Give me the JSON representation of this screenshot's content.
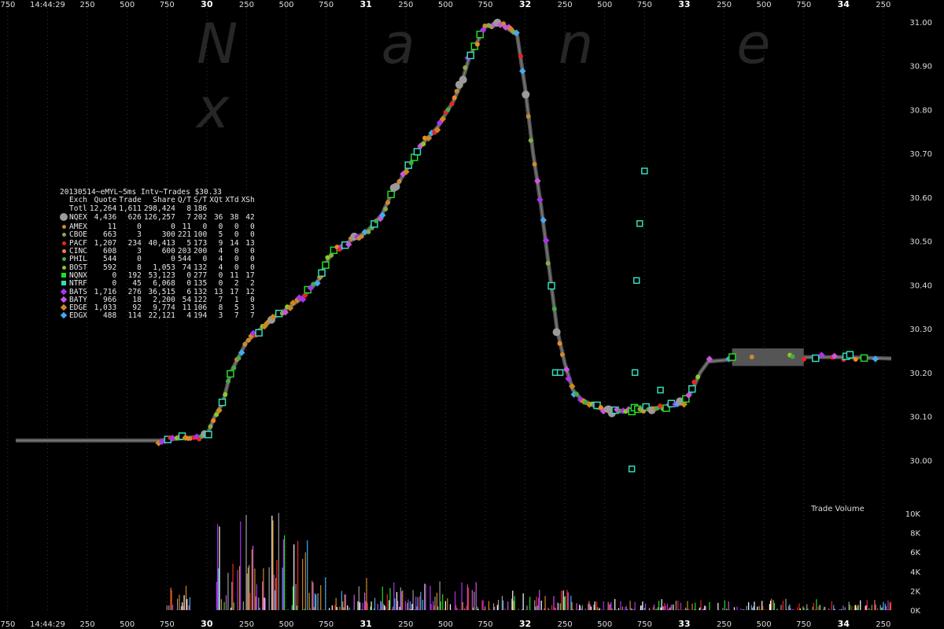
{
  "watermark": "N a n e x",
  "legend": {
    "title": "20130514~eMYL~5ms Intv~Trades $30.33",
    "columns": [
      "Exch",
      "Quote",
      "Trade",
      "Share",
      "Q/T",
      "S/T",
      "XQt",
      "XTd",
      "XSh"
    ],
    "rows": [
      {
        "exch": "Totl",
        "quote": "12,264",
        "trade": "1,611",
        "share": "298,424",
        "qt": "8",
        "st": "186",
        "xqt": "",
        "xtd": "",
        "xsh": "",
        "color": "",
        "shape": "none"
      },
      {
        "exch": "NQEX",
        "quote": "4,436",
        "trade": "626",
        "share": "126,257",
        "qt": "7",
        "st": "202",
        "xqt": "36",
        "xtd": "38",
        "xsh": "42",
        "color": "#9a9a9a",
        "shape": "circle"
      },
      {
        "exch": "AMEX",
        "quote": "11",
        "trade": "0",
        "share": "0",
        "qt": "11",
        "st": "0",
        "xqt": "0",
        "xtd": "0",
        "xsh": "0",
        "color": "#cc8833",
        "shape": "dot"
      },
      {
        "exch": "CBOE",
        "quote": "663",
        "trade": "3",
        "share": "300",
        "qt": "221",
        "st": "100",
        "xqt": "5",
        "xtd": "0",
        "xsh": "0",
        "color": "#88aa44",
        "shape": "dot"
      },
      {
        "exch": "PACF",
        "quote": "1,207",
        "trade": "234",
        "share": "40,413",
        "qt": "5",
        "st": "173",
        "xqt": "9",
        "xtd": "14",
        "xsh": "13",
        "color": "#ee2222",
        "shape": "dot"
      },
      {
        "exch": "CINC",
        "quote": "608",
        "trade": "3",
        "share": "600",
        "qt": "203",
        "st": "200",
        "xqt": "4",
        "xtd": "0",
        "xsh": "0",
        "color": "#ee8822",
        "shape": "dot"
      },
      {
        "exch": "PHIL",
        "quote": "544",
        "trade": "0",
        "share": "0",
        "qt": "544",
        "st": "0",
        "xqt": "4",
        "xtd": "0",
        "xsh": "0",
        "color": "#44aa44",
        "shape": "dot"
      },
      {
        "exch": "BOST",
        "quote": "592",
        "trade": "8",
        "share": "1,053",
        "qt": "74",
        "st": "132",
        "xqt": "4",
        "xtd": "0",
        "xsh": "0",
        "color": "#88cc22",
        "shape": "dot"
      },
      {
        "exch": "NQNX",
        "quote": "0",
        "trade": "192",
        "share": "53,123",
        "qt": "0",
        "st": "277",
        "xqt": "0",
        "xtd": "11",
        "xsh": "17",
        "color": "#22dd22",
        "shape": "square"
      },
      {
        "exch": "NTRF",
        "quote": "0",
        "trade": "45",
        "share": "6,068",
        "qt": "0",
        "st": "135",
        "xqt": "0",
        "xtd": "2",
        "xsh": "2",
        "color": "#33ddbb",
        "shape": "square"
      },
      {
        "exch": "BATS",
        "quote": "1,716",
        "trade": "276",
        "share": "36,515",
        "qt": "6",
        "st": "132",
        "xqt": "13",
        "xtd": "17",
        "xsh": "12",
        "color": "#aa33ee",
        "shape": "diamond"
      },
      {
        "exch": "BATY",
        "quote": "966",
        "trade": "18",
        "share": "2,200",
        "qt": "54",
        "st": "122",
        "xqt": "7",
        "xtd": "1",
        "xsh": "0",
        "color": "#cc55dd",
        "shape": "diamond"
      },
      {
        "exch": "EDGE",
        "quote": "1,033",
        "trade": "92",
        "share": "9,774",
        "qt": "11",
        "st": "106",
        "xqt": "8",
        "xtd": "5",
        "xsh": "3",
        "color": "#cc8822",
        "shape": "diamond"
      },
      {
        "exch": "EDGX",
        "quote": "488",
        "trade": "114",
        "share": "22,121",
        "qt": "4",
        "st": "194",
        "xqt": "3",
        "xtd": "7",
        "xsh": "7",
        "color": "#44aaee",
        "shape": "diamond"
      }
    ]
  },
  "chart_data": {
    "type": "scatter",
    "title": "20130514~eMYL~5ms Intv~Trades $30.33",
    "x_unit": "ms",
    "x_ticks": [
      "750",
      "14:44:29",
      "250",
      "500",
      "750",
      "30",
      "250",
      "500",
      "750",
      "31",
      "250",
      "500",
      "750",
      "32",
      "250",
      "500",
      "750",
      "33",
      "250",
      "500",
      "750",
      "34",
      "250"
    ],
    "x_tick_ms": [
      -250,
      0,
      250,
      500,
      750,
      1000,
      1250,
      1500,
      1750,
      2000,
      2250,
      2500,
      2750,
      3000,
      3250,
      3500,
      3750,
      4000,
      4250,
      4500,
      4750,
      5000,
      5250
    ],
    "major_tick_labels": [
      "30",
      "31",
      "32",
      "33",
      "34"
    ],
    "xlim_ms": [
      -200,
      5310
    ],
    "y_ticks": [
      "31.00",
      "30.90",
      "30.80",
      "30.70",
      "30.60",
      "30.50",
      "30.40",
      "30.30",
      "30.20",
      "30.10",
      "30.00"
    ],
    "ylim": [
      29.97,
      31.0
    ],
    "price_path": [
      [
        -200,
        30.045
      ],
      [
        700,
        30.045
      ],
      [
        1000,
        30.055
      ],
      [
        1050,
        30.1
      ],
      [
        1100,
        30.13
      ],
      [
        1150,
        30.2
      ],
      [
        1250,
        30.27
      ],
      [
        1400,
        30.32
      ],
      [
        1600,
        30.37
      ],
      [
        1700,
        30.41
      ],
      [
        1750,
        30.45
      ],
      [
        1800,
        30.48
      ],
      [
        1900,
        30.5
      ],
      [
        2000,
        30.52
      ],
      [
        2100,
        30.56
      ],
      [
        2150,
        30.6
      ],
      [
        2250,
        30.66
      ],
      [
        2350,
        30.72
      ],
      [
        2450,
        30.76
      ],
      [
        2550,
        30.82
      ],
      [
        2600,
        30.86
      ],
      [
        2650,
        30.92
      ],
      [
        2750,
        30.99
      ],
      [
        2850,
        30.995
      ],
      [
        2950,
        30.97
      ],
      [
        3000,
        30.85
      ],
      [
        3050,
        30.7
      ],
      [
        3100,
        30.58
      ],
      [
        3150,
        30.44
      ],
      [
        3200,
        30.3
      ],
      [
        3250,
        30.22
      ],
      [
        3300,
        30.16
      ],
      [
        3350,
        30.14
      ],
      [
        3450,
        30.12
      ],
      [
        3550,
        30.11
      ],
      [
        3700,
        30.115
      ],
      [
        3850,
        30.12
      ],
      [
        4000,
        30.13
      ],
      [
        4050,
        30.16
      ],
      [
        4100,
        30.2
      ],
      [
        4150,
        30.225
      ],
      [
        4300,
        30.23
      ],
      [
        4700,
        30.235
      ],
      [
        5000,
        30.235
      ],
      [
        5300,
        30.232
      ]
    ],
    "volume_axis": {
      "label": "Trade Volume",
      "ticks": [
        "10K",
        "8K",
        "6K",
        "4K",
        "2K",
        "0K"
      ],
      "tick_values": [
        10000,
        8000,
        6000,
        4000,
        2000,
        0
      ],
      "ylim": [
        0,
        10000
      ]
    },
    "volume_clusters": [
      {
        "x_range": [
          750,
          900
        ],
        "max": 3000
      },
      {
        "x_range": [
          1050,
          1650
        ],
        "max": 10500
      },
      {
        "x_range": [
          1650,
          2050
        ],
        "max": 3500
      },
      {
        "x_range": [
          2050,
          2700
        ],
        "max": 3000
      },
      {
        "x_range": [
          2700,
          3300
        ],
        "max": 2200
      },
      {
        "x_range": [
          3300,
          5300
        ],
        "max": 1200
      }
    ]
  }
}
